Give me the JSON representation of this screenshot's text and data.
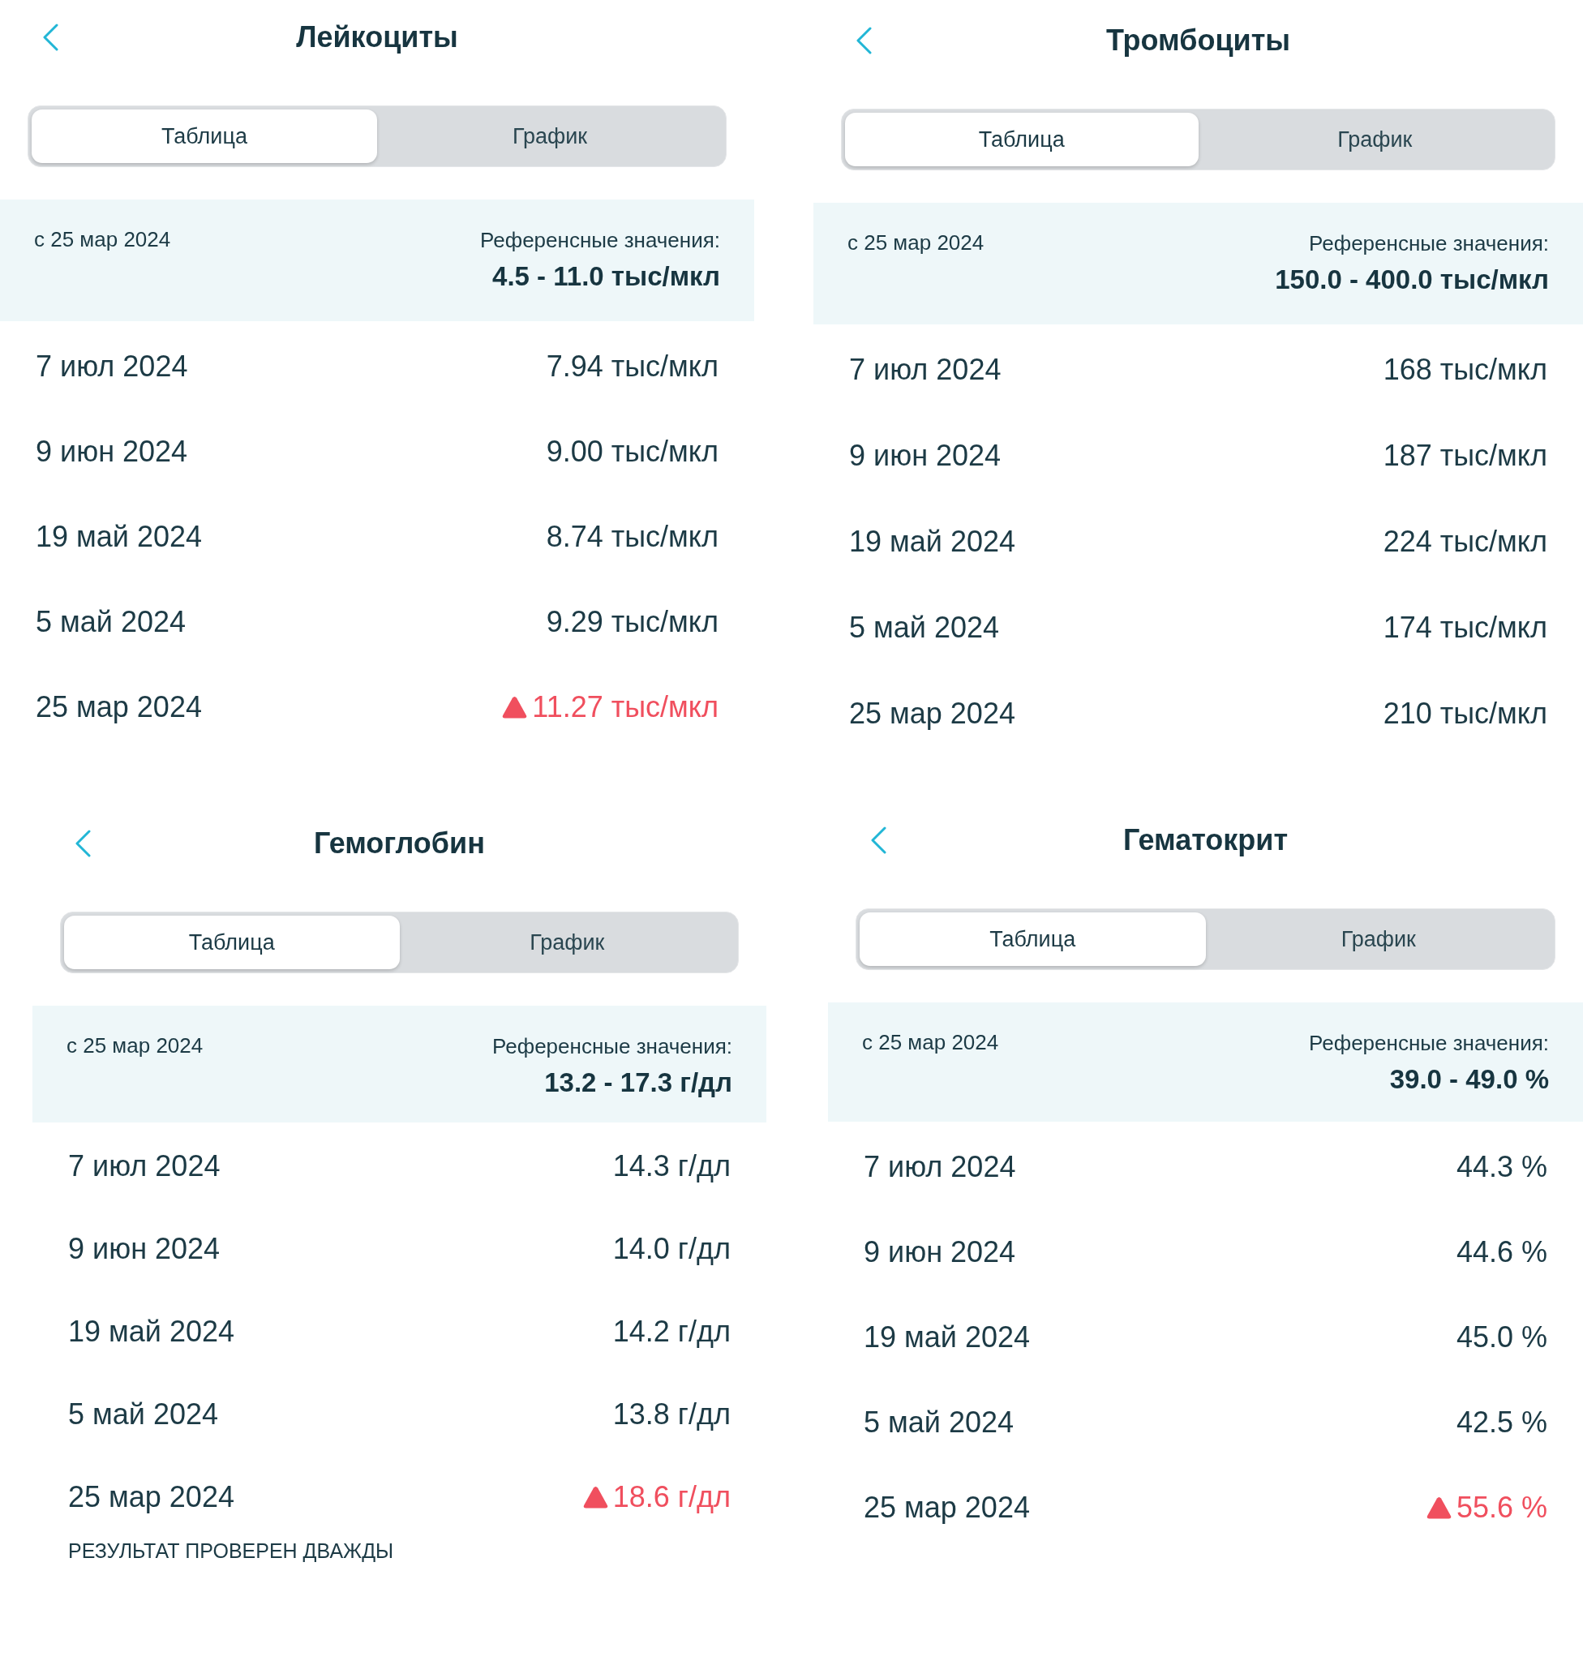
{
  "panels": [
    {
      "title": "Лейкоциты",
      "tabs": [
        {
          "label": "Таблица",
          "selected": true
        },
        {
          "label": "График",
          "selected": false
        }
      ],
      "reference": {
        "since": "с 25 мар 2024",
        "label": "Референсные значения:",
        "range": "4.5 - 11.0 тыс/мкл"
      },
      "rows": [
        {
          "date": "7 июл 2024",
          "value": "7.94 тыс/мкл",
          "high": false
        },
        {
          "date": "9 июн 2024",
          "value": "9.00 тыс/мкл",
          "high": false
        },
        {
          "date": "19 май 2024",
          "value": "8.74 тыс/мкл",
          "high": false
        },
        {
          "date": "5 май 2024",
          "value": "9.29 тыс/мкл",
          "high": false
        },
        {
          "date": "25 мар 2024",
          "value": "11.27 тыс/мкл",
          "high": true
        }
      ]
    },
    {
      "title": "Тромбоциты",
      "tabs": [
        {
          "label": "Таблица",
          "selected": true
        },
        {
          "label": "График",
          "selected": false
        }
      ],
      "reference": {
        "since": "с 25 мар 2024",
        "label": "Референсные значения:",
        "range": "150.0 - 400.0 тыс/мкл"
      },
      "rows": [
        {
          "date": "7 июл 2024",
          "value": "168 тыс/мкл",
          "high": false
        },
        {
          "date": "9 июн 2024",
          "value": "187 тыс/мкл",
          "high": false
        },
        {
          "date": "19 май 2024",
          "value": "224 тыс/мкл",
          "high": false
        },
        {
          "date": "5 май 2024",
          "value": "174 тыс/мкл",
          "high": false
        },
        {
          "date": "25 мар 2024",
          "value": "210 тыс/мкл",
          "high": false
        }
      ]
    },
    {
      "title": "Гемоглобин",
      "tabs": [
        {
          "label": "Таблица",
          "selected": true
        },
        {
          "label": "График",
          "selected": false
        }
      ],
      "reference": {
        "since": "с 25 мар 2024",
        "label": "Референсные значения:",
        "range": "13.2 - 17.3 г/дл"
      },
      "rows": [
        {
          "date": "7 июл 2024",
          "value": "14.3 г/дл",
          "high": false
        },
        {
          "date": "9 июн 2024",
          "value": "14.0 г/дл",
          "high": false
        },
        {
          "date": "19 май 2024",
          "value": "14.2 г/дл",
          "high": false
        },
        {
          "date": "5 май 2024",
          "value": "13.8 г/дл",
          "high": false
        },
        {
          "date": "25 мар 2024",
          "value": "18.6 г/дл",
          "high": true,
          "note": "РЕЗУЛЬТАТ ПРОВЕРЕН ДВАЖДЫ"
        }
      ]
    },
    {
      "title": "Гематокрит",
      "tabs": [
        {
          "label": "Таблица",
          "selected": true
        },
        {
          "label": "График",
          "selected": false
        }
      ],
      "reference": {
        "since": "с 25 мар 2024",
        "label": "Референсные значения:",
        "range": "39.0 - 49.0 %"
      },
      "rows": [
        {
          "date": "7 июл 2024",
          "value": "44.3 %",
          "high": false
        },
        {
          "date": "9 июн 2024",
          "value": "44.6 %",
          "high": false
        },
        {
          "date": "19 май 2024",
          "value": "45.0 %",
          "high": false
        },
        {
          "date": "5 май 2024",
          "value": "42.5 %",
          "high": false
        },
        {
          "date": "25 мар 2024",
          "value": "55.6 %",
          "high": true
        }
      ]
    }
  ]
}
